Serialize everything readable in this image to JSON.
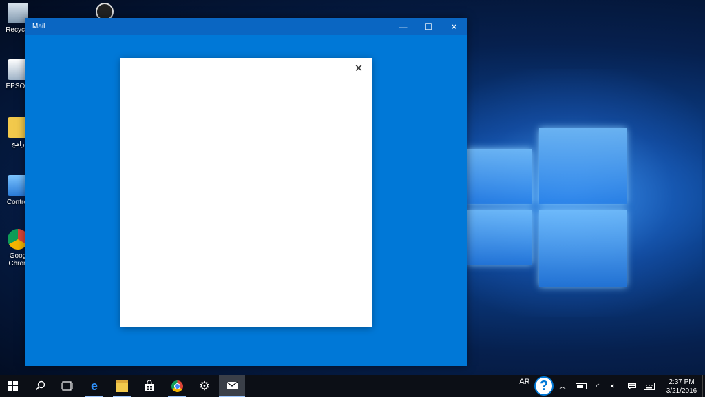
{
  "desktop": {
    "icons": [
      {
        "label": "Recycle"
      },
      {
        "label": "EPSON"
      },
      {
        "label": "رامج"
      },
      {
        "label": "Control"
      },
      {
        "label": "Goog Chron"
      }
    ]
  },
  "window": {
    "title": "Mail",
    "controls": {
      "minimize": "—",
      "maximize": "☐",
      "close": "✕"
    },
    "dialog": {
      "close": "✕"
    }
  },
  "taskbar": {
    "apps": [
      "start",
      "search",
      "task-view",
      "edge",
      "file-explorer",
      "store",
      "chrome",
      "settings",
      "mail"
    ],
    "active_app": "mail",
    "language": "AR",
    "help": "?",
    "clock": {
      "time": "2:37 PM",
      "date": "3/21/2016"
    }
  },
  "colors": {
    "window_bg": "#0078d7",
    "titlebar": "#0a66c2",
    "taskbar": "#0c0f16",
    "dialog_bg": "#ffffff"
  }
}
